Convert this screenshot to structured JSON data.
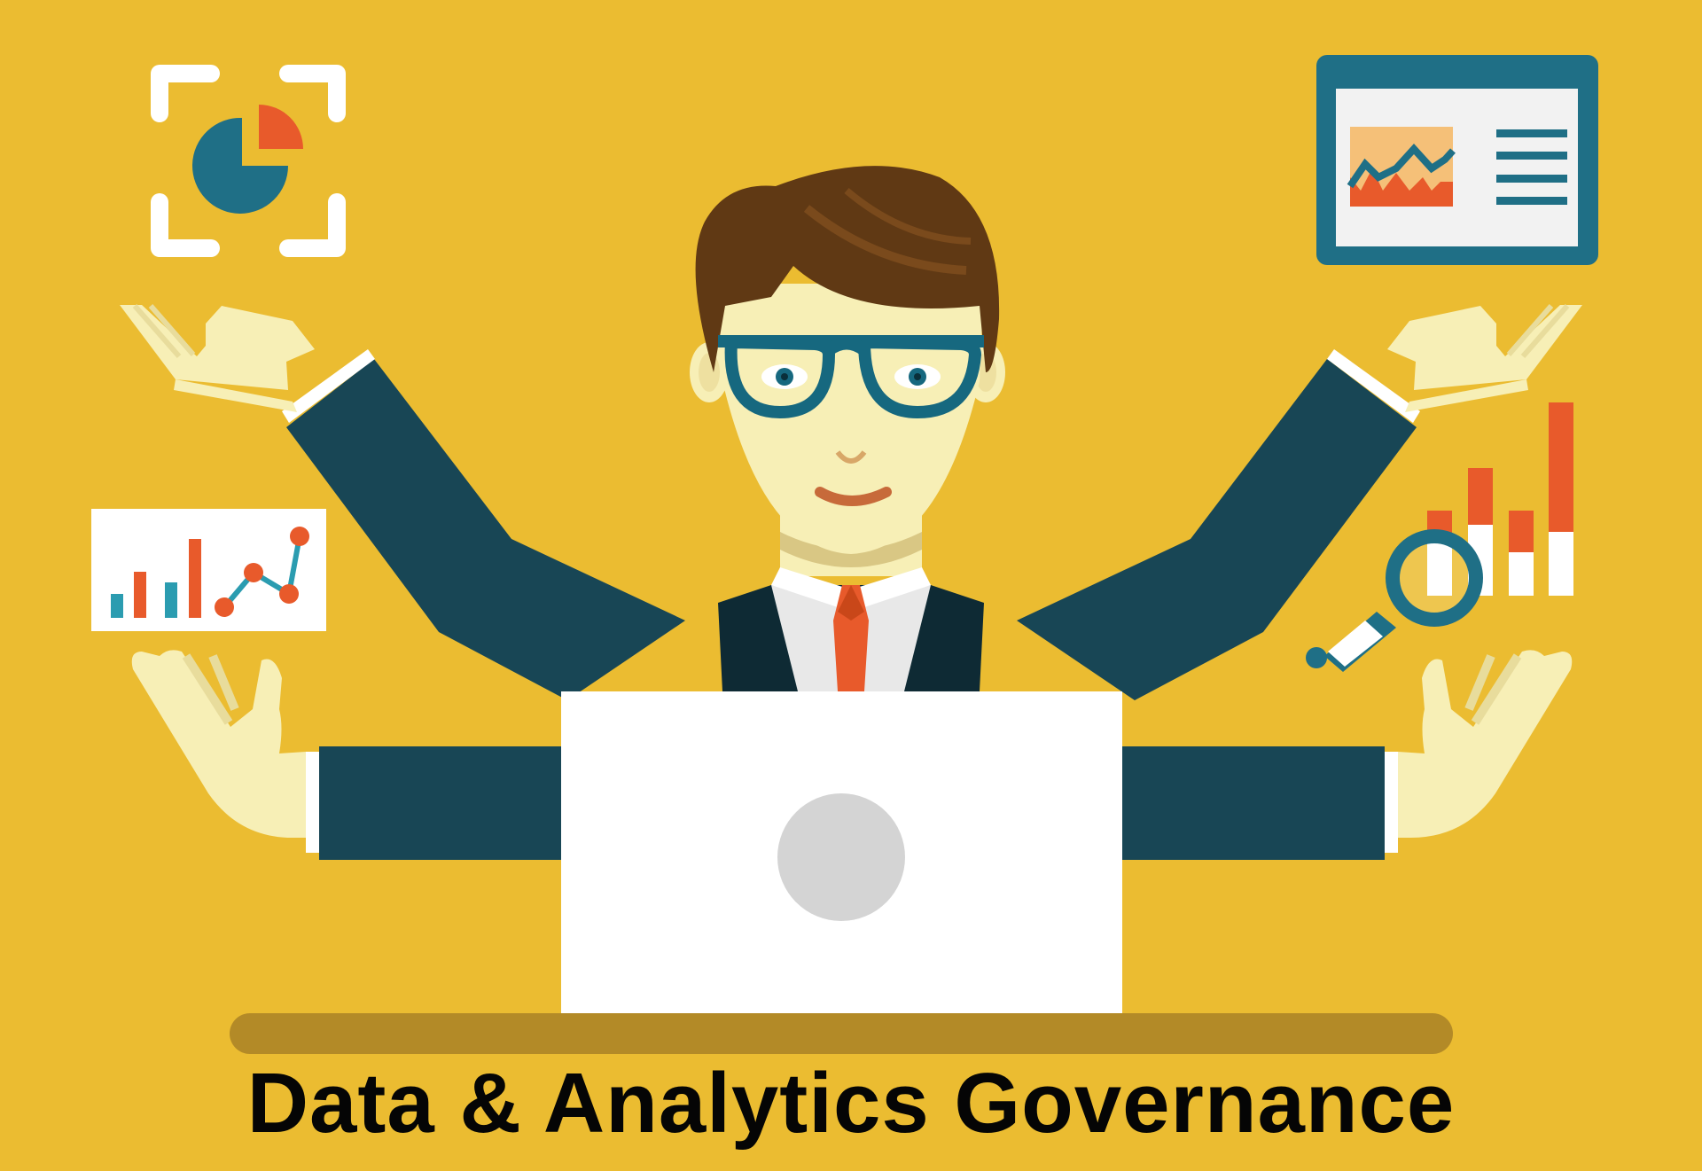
{
  "caption": "Data & Analytics Governance",
  "colors": {
    "background": "#ebbc31",
    "suit": "#184655",
    "suit_dark": "#0e2a34",
    "skin": "#f7efb6",
    "hair": "#603914",
    "glasses": "#16687f",
    "accent_orange": "#e85a2b",
    "accent_teal": "#1f6f86",
    "laptop": "#ffffff",
    "desk": "#b38a27",
    "text": "#050505"
  },
  "icons": {
    "top_left": "pie-chart-focus-icon",
    "top_right": "dashboard-window-icon",
    "left": "bar-and-line-chart-card-icon",
    "right": "bar-chart-magnifier-icon",
    "center": "laptop-icon"
  }
}
